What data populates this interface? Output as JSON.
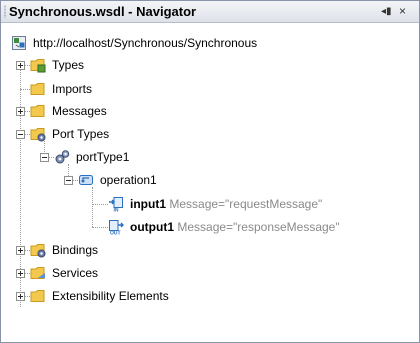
{
  "window": {
    "title": "Synchronous.wsdl - Navigator",
    "restore_glyph": "◂▮",
    "close_glyph": "×"
  },
  "tree": {
    "root": {
      "label": "http://localhost/Synchronous/Synchronous",
      "icon": "wsdl-file-icon"
    },
    "types": {
      "label": "Types",
      "icon": "folder-types-icon"
    },
    "imports": {
      "label": "Imports",
      "icon": "folder-icon"
    },
    "messages": {
      "label": "Messages",
      "icon": "folder-messages-icon"
    },
    "port_types": {
      "label": "Port Types",
      "icon": "folder-porttypes-icon"
    },
    "port_type1": {
      "label": "portType1",
      "icon": "gears-icon"
    },
    "operation1": {
      "label": "operation1",
      "icon": "operation-icon"
    },
    "input1": {
      "label": "input1",
      "attr": "Message=\"requestMessage\"",
      "icon": "input-icon"
    },
    "output1": {
      "label": "output1",
      "attr": "Message=\"responseMessage\"",
      "icon": "output-icon"
    },
    "bindings": {
      "label": "Bindings",
      "icon": "folder-bindings-icon"
    },
    "services": {
      "label": "Services",
      "icon": "folder-services-icon"
    },
    "extensibility": {
      "label": "Extensibility Elements",
      "icon": "folder-icon"
    }
  },
  "colors": {
    "folder": "#f2c94c",
    "folder_dark": "#c99a1e",
    "accent_blue": "#2a6fc0",
    "attr_gray": "#8a8a8a"
  }
}
